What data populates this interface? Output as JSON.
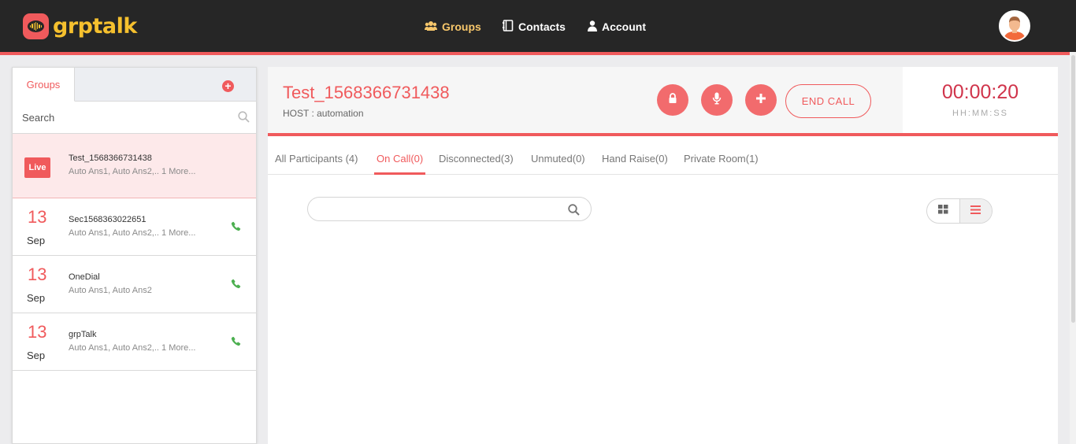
{
  "app": {
    "logo_text": "grptalk"
  },
  "nav": [
    {
      "label": "Groups",
      "icon": "users-icon",
      "active": true
    },
    {
      "label": "Contacts",
      "icon": "contacts-book-icon"
    },
    {
      "label": "Account",
      "icon": "user-icon"
    }
  ],
  "sidebar": {
    "tab_label": "Groups",
    "search_placeholder": "Search",
    "groups": [
      {
        "badge": "Live",
        "name": "Test_1568366731438",
        "members": "Auto Ans1, Auto Ans2,.. 1 More..."
      },
      {
        "day": "13",
        "month": "Sep",
        "name": "Sec1568363022651",
        "members": "Auto Ans1, Auto Ans2,.. 1 More...",
        "icon": "phone-icon"
      },
      {
        "day": "13",
        "month": "Sep",
        "name": "OneDial",
        "members": "Auto Ans1, Auto Ans2",
        "icon": "phone-icon"
      },
      {
        "day": "13",
        "month": "Sep",
        "name": "grpTalk",
        "members": "Auto Ans1, Auto Ans2,.. 1 More...",
        "icon": "phone-icon"
      }
    ]
  },
  "call": {
    "title": "Test_1568366731438",
    "host": "HOST : automation",
    "end_call_label": "END CALL",
    "timer": "00:00:20",
    "timer_format": "HH:MM:SS",
    "action_icons": [
      "lock-icon",
      "mic-icon",
      "plus-icon"
    ]
  },
  "tabs": [
    {
      "label": "All Participants (4)"
    },
    {
      "label": "On Call(0)",
      "active": true
    },
    {
      "label": "Disconnected(3)"
    },
    {
      "label": "Unmuted(0)"
    },
    {
      "label": "Hand Raise(0)"
    },
    {
      "label": "Private Room(1)"
    }
  ],
  "colors": {
    "accent": "#f05a5c",
    "logo": "#f5c02e",
    "topbar": "#262626",
    "timer": "#d0344b",
    "phone": "#4caf50"
  }
}
